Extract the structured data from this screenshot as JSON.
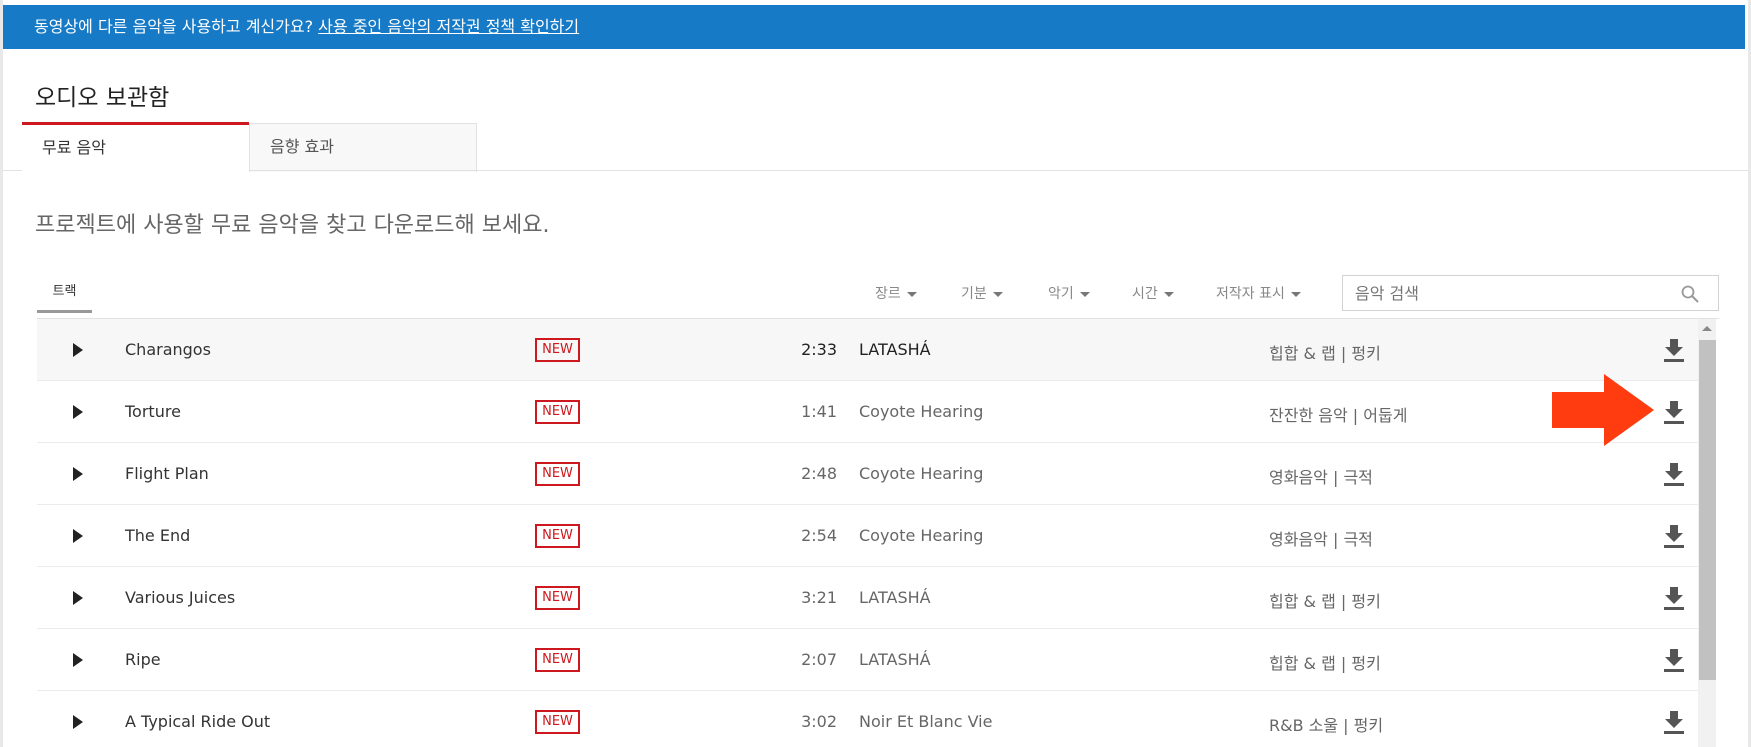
{
  "banner": {
    "text": "동영상에 다른 음악을 사용하고 계신가요?",
    "link": "사용 중인 음악의 저작권 정책 확인하기"
  },
  "page_title": "오디오 보관함",
  "tabs": [
    {
      "label": "무료 음악",
      "active": true
    },
    {
      "label": "음향 효과",
      "active": false
    }
  ],
  "subtitle": "프로젝트에 사용할 무료 음악을 찾고 다운로드해 보세요.",
  "track_tab": "트랙",
  "filters": [
    "장르",
    "기분",
    "악기",
    "시간",
    "저작자 표시"
  ],
  "search": {
    "placeholder": "음악 검색"
  },
  "tracks": [
    {
      "title": "Charangos",
      "badge": "NEW",
      "duration": "2:33",
      "artist": "LATASHÁ",
      "genre": "힙합 & 랩 | 펑키"
    },
    {
      "title": "Torture",
      "badge": "NEW",
      "duration": "1:41",
      "artist": "Coyote Hearing",
      "genre": "잔잔한 음악 | 어둡게"
    },
    {
      "title": "Flight Plan",
      "badge": "NEW",
      "duration": "2:48",
      "artist": "Coyote Hearing",
      "genre": "영화음악 | 극적"
    },
    {
      "title": "The End",
      "badge": "NEW",
      "duration": "2:54",
      "artist": "Coyote Hearing",
      "genre": "영화음악 | 극적"
    },
    {
      "title": "Various Juices",
      "badge": "NEW",
      "duration": "3:21",
      "artist": "LATASHÁ",
      "genre": "힙합 & 랩 | 펑키"
    },
    {
      "title": "Ripe",
      "badge": "NEW",
      "duration": "2:07",
      "artist": "LATASHÁ",
      "genre": "힙합 & 랩 | 펑키"
    },
    {
      "title": "A Typical Ride Out",
      "badge": "NEW",
      "duration": "3:02",
      "artist": "Noir Et Blanc Vie",
      "genre": "R&B 소울 | 펑키"
    }
  ],
  "colors": {
    "banner": "#167ac6",
    "accent_red": "#cc181e",
    "annotation_arrow": "#ff3b10"
  },
  "icons": {
    "play": "play-icon",
    "download": "download-icon",
    "search": "search-icon"
  }
}
